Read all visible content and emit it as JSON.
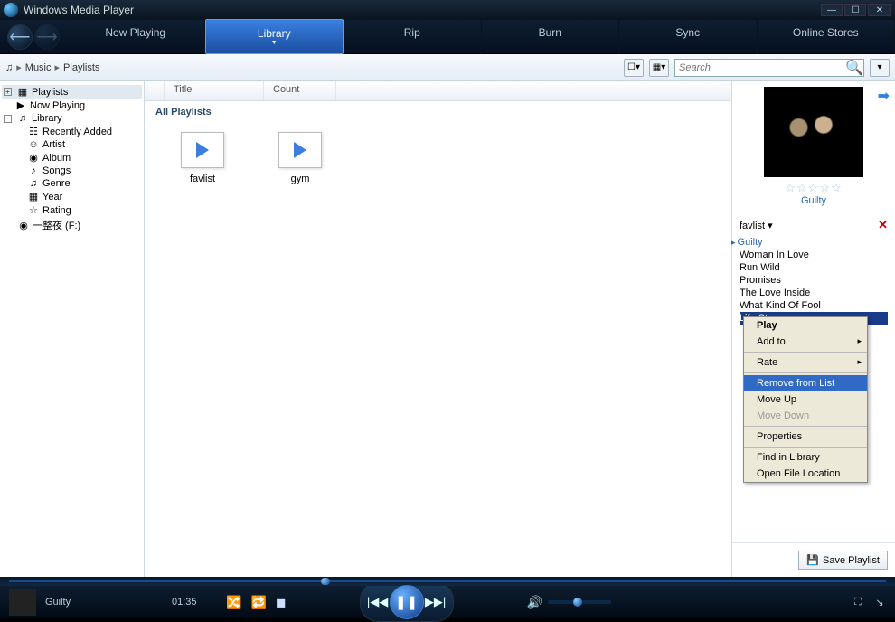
{
  "app_title": "Windows Media Player",
  "nav_tabs": [
    "Now Playing",
    "Library",
    "Rip",
    "Burn",
    "Sync",
    "Online Stores"
  ],
  "active_tab_index": 1,
  "breadcrumb": {
    "root_icon": "♫",
    "parts": [
      "Music",
      "Playlists"
    ]
  },
  "search": {
    "placeholder": "Search"
  },
  "sidebar": {
    "items": [
      {
        "label": "Playlists",
        "expander": "+",
        "icon": "▦",
        "selected": true,
        "indent": 0
      },
      {
        "label": "Now Playing",
        "icon": "▶",
        "indent": 1
      },
      {
        "label": "Library",
        "expander": "-",
        "icon": "♫",
        "indent": 0
      },
      {
        "label": "Recently Added",
        "icon": "☷",
        "indent": 2
      },
      {
        "label": "Artist",
        "icon": "☺",
        "indent": 2
      },
      {
        "label": "Album",
        "icon": "◉",
        "indent": 2
      },
      {
        "label": "Songs",
        "icon": "♪",
        "indent": 2
      },
      {
        "label": "Genre",
        "icon": "♫",
        "indent": 2
      },
      {
        "label": "Year",
        "icon": "▦",
        "indent": 2
      },
      {
        "label": "Rating",
        "icon": "☆",
        "indent": 2
      },
      {
        "label": "一整夜 (F:)",
        "icon": "◉",
        "indent": 0
      }
    ]
  },
  "columns": {
    "title": "Title",
    "count": "Count"
  },
  "section_label": "All Playlists",
  "playlists": [
    {
      "name": "favlist"
    },
    {
      "name": "gym"
    }
  ],
  "right": {
    "album_title": "Guilty",
    "playlist_name": "favlist",
    "tracks": [
      {
        "title": "Guilty",
        "playing": true
      },
      {
        "title": "Woman In Love"
      },
      {
        "title": "Run Wild"
      },
      {
        "title": "Promises"
      },
      {
        "title": "The Love Inside"
      },
      {
        "title": "What Kind Of Fool"
      },
      {
        "title": "Life Story",
        "selected": true
      }
    ],
    "save_label": "Save Playlist"
  },
  "context_menu": {
    "items": [
      {
        "label": "Play",
        "bold": true
      },
      {
        "label": "Add to",
        "submenu": true
      },
      {
        "sep": true
      },
      {
        "label": "Rate",
        "submenu": true
      },
      {
        "sep": true
      },
      {
        "label": "Remove from List",
        "selected": true
      },
      {
        "label": "Move Up"
      },
      {
        "label": "Move Down",
        "disabled": true
      },
      {
        "sep": true
      },
      {
        "label": "Properties"
      },
      {
        "sep": true
      },
      {
        "label": "Find in Library"
      },
      {
        "label": "Open File Location"
      }
    ]
  },
  "player": {
    "now_playing": "Guilty",
    "elapsed": "01:35"
  }
}
